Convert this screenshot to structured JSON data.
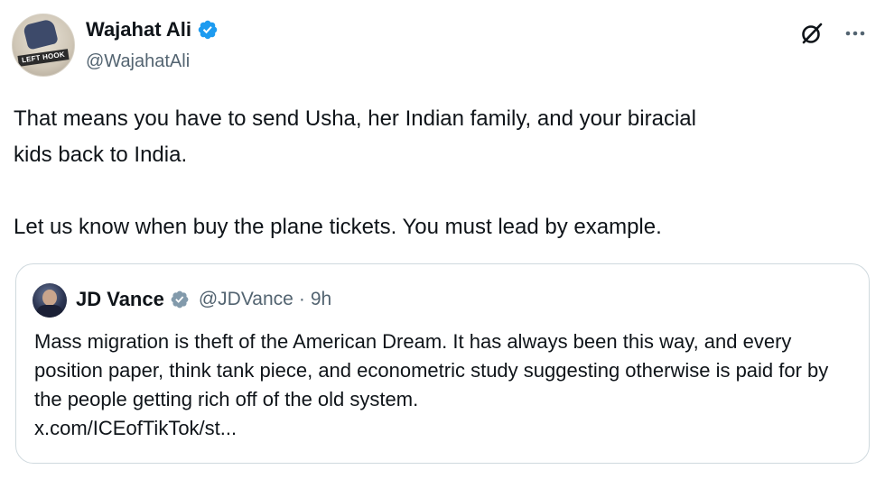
{
  "author": {
    "display_name": "Wajahat Ali",
    "handle": "@WajahatAli",
    "avatar_text": "LEFT HOOK"
  },
  "tweet": {
    "text": "That means you have to send Usha, her Indian family, and your biracial\nkids back to India.\n\nLet us know when buy the plane tickets. You must lead by example."
  },
  "quoted": {
    "display_name": "JD Vance",
    "handle": "@JDVance",
    "separator": "·",
    "time": "9h",
    "text": "Mass migration is theft of the American Dream. It has always been this way, and every position paper, think tank piece, and econometric study suggesting otherwise is paid for by the people getting rich off of the old system.",
    "link": "x.com/ICEofTikTok/st..."
  },
  "icons": {
    "verified": "verified-badge-icon",
    "grok": "grok-icon",
    "more": "more-options-icon"
  },
  "colors": {
    "verified_blue": "#1d9bf0",
    "verified_gray": "#829aab",
    "text_primary": "#0f1419",
    "text_secondary": "#536471",
    "border": "#cfd9de"
  }
}
